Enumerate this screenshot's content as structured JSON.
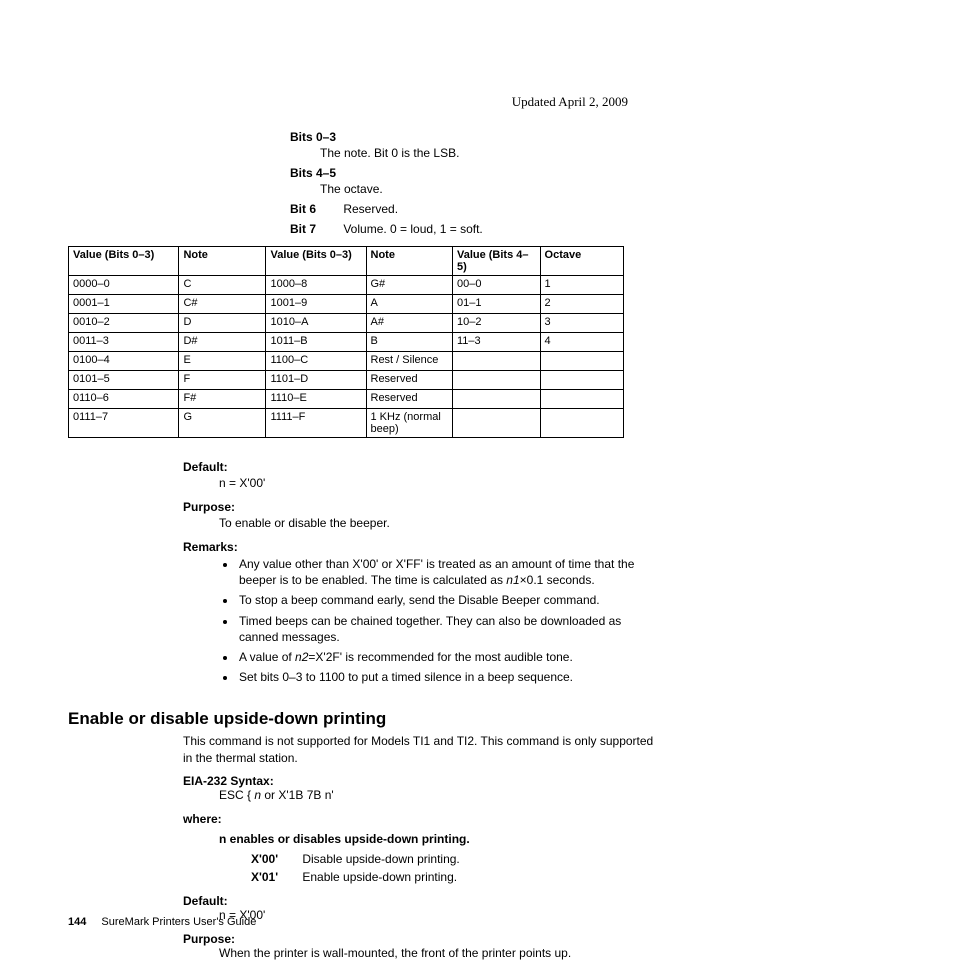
{
  "updated": "Updated April 2, 2009",
  "bits": {
    "b03_term": "Bits 0–3",
    "b03_def": "The note. Bit 0 is the LSB.",
    "b45_term": "Bits 4–5",
    "b45_def": "The octave.",
    "b6_term": "Bit 6",
    "b6_def": "Reserved.",
    "b7_term": "Bit 7",
    "b7_def": "Volume. 0 = loud, 1 = soft."
  },
  "table": {
    "headers": {
      "h1": "Value (Bits 0–3)",
      "h2": "Note",
      "h3": "Value (Bits 0–3)",
      "h4": "Note",
      "h5": "Value (Bits 4–5)",
      "h6": "Octave"
    },
    "rows": [
      {
        "a": "0000–0",
        "b": "C",
        "c": "1000–8",
        "d": "G#",
        "e": "00–0",
        "f": "1"
      },
      {
        "a": "0001–1",
        "b": "C#",
        "c": "1001–9",
        "d": "A",
        "e": "01–1",
        "f": "2"
      },
      {
        "a": "0010–2",
        "b": "D",
        "c": "1010–A",
        "d": "A#",
        "e": "10–2",
        "f": "3"
      },
      {
        "a": "0011–3",
        "b": "D#",
        "c": "1011–B",
        "d": "B",
        "e": "11–3",
        "f": "4"
      },
      {
        "a": "0100–4",
        "b": "E",
        "c": "1100–C",
        "d": "Rest / Silence",
        "e": "",
        "f": ""
      },
      {
        "a": "0101–5",
        "b": "F",
        "c": "1101–D",
        "d": "Reserved",
        "e": "",
        "f": ""
      },
      {
        "a": "0110–6",
        "b": "F#",
        "c": "1110–E",
        "d": "Reserved",
        "e": "",
        "f": ""
      },
      {
        "a": "0111–7",
        "b": "G",
        "c": "1111–F",
        "d": "1 KHz (normal beep)",
        "e": "",
        "f": ""
      }
    ]
  },
  "defaults": {
    "default_label": "Default:",
    "default_value": "n = X'00'",
    "purpose_label": "Purpose:",
    "purpose_value": "To enable or disable the beeper.",
    "remarks_label": "Remarks:",
    "remarks": {
      "r1a": "Any value other than X'00' or X'FF' is treated as an amount of time that the beeper is to be enabled. The time is calculated as ",
      "r1b": "n1",
      "r1c": "×0.1 seconds.",
      "r2": "To stop a beep command early, send the Disable Beeper command.",
      "r3": "Timed beeps can be chained together. They can also be downloaded as canned messages.",
      "r4a": "A value of ",
      "r4b": "n2",
      "r4c": "=X'2F' is recommended for the most audible tone.",
      "r5": "Set bits 0–3 to 1100 to put a timed silence in a beep sequence."
    }
  },
  "section2": {
    "heading": "Enable or disable upside-down printing",
    "intro": "This command is not supported for Models TI1 and TI2. This command is only supported in the thermal station.",
    "syntax_label": "EIA-232 Syntax:",
    "syntax_a": "ESC { ",
    "syntax_b": "n",
    "syntax_c": " or X'1B 7B n'",
    "where_label": "where:",
    "where_intro": "n enables or disables upside-down printing.",
    "opt00_k": "X'00'",
    "opt00_v": "Disable upside-down printing.",
    "opt01_k": "X'01'",
    "opt01_v": "Enable upside-down printing.",
    "default_label": "Default:",
    "default_value": "n = X'00'",
    "purpose_label": "Purpose:",
    "purpose_value": "When the printer is wall-mounted, the front of the printer points up."
  },
  "footer": {
    "page": "144",
    "title": "SureMark Printers User's Guide"
  }
}
